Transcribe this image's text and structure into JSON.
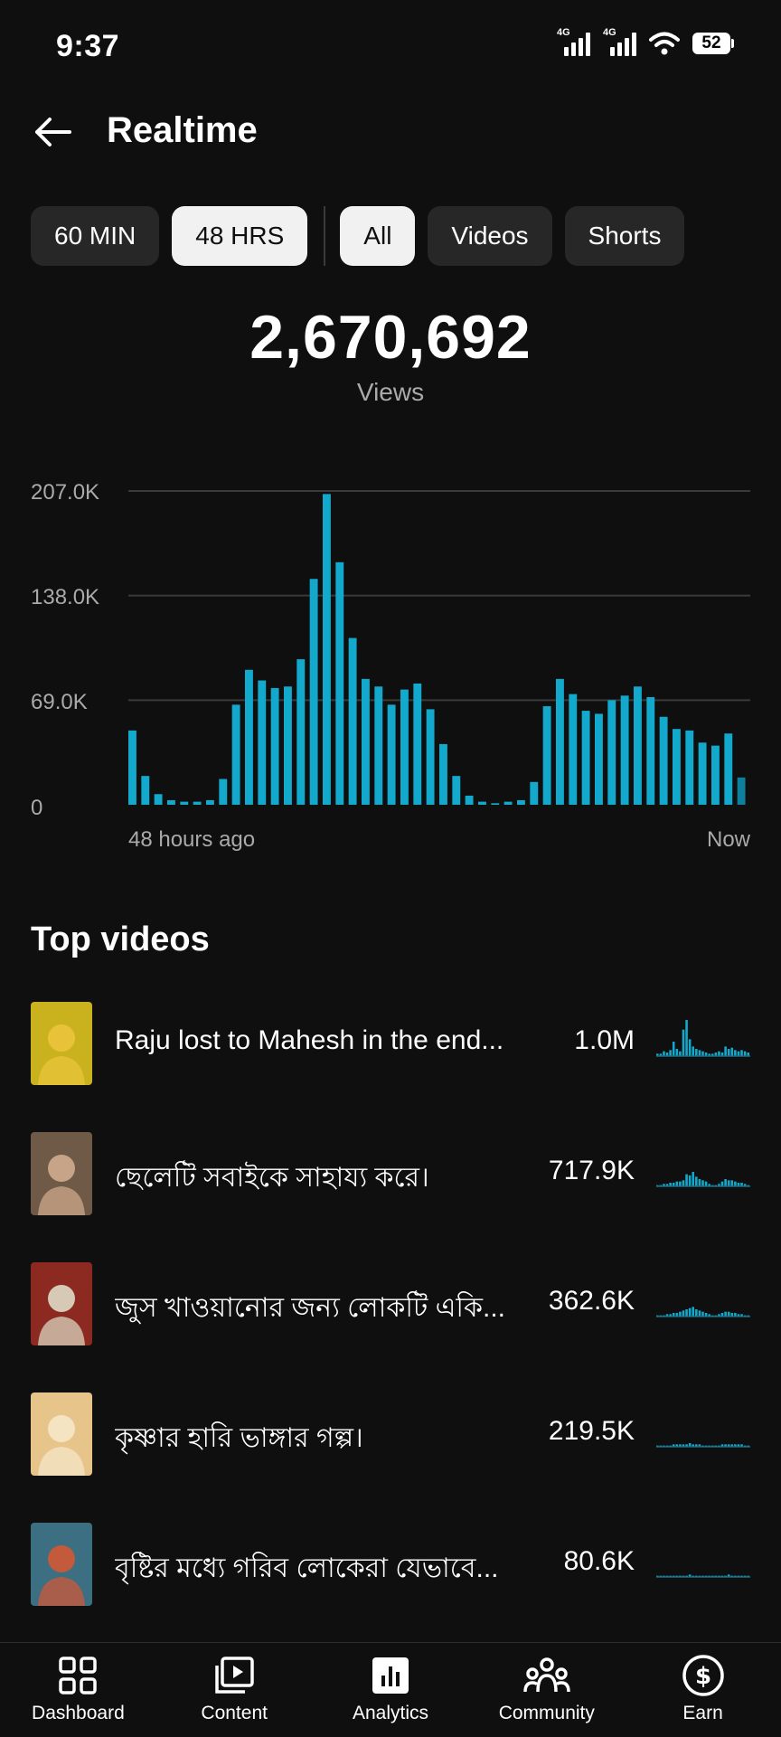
{
  "status_bar": {
    "time": "9:37",
    "network_1": "4G",
    "network_2": "4G",
    "battery": "52",
    "icons": [
      "signal-icon",
      "signal-icon",
      "wifi-icon",
      "battery-icon"
    ]
  },
  "header": {
    "title": "Realtime",
    "back_icon": "arrow-left-icon"
  },
  "time_filters": [
    {
      "label": "60 MIN",
      "active": false
    },
    {
      "label": "48 HRS",
      "active": true
    }
  ],
  "type_filters": [
    {
      "label": "All",
      "active": true
    },
    {
      "label": "Videos",
      "active": false
    },
    {
      "label": "Shorts",
      "active": false
    }
  ],
  "total": {
    "value": "2,670,692",
    "label": "Views"
  },
  "chart_data": {
    "type": "bar",
    "y_ticks": [
      "207.0K",
      "138.0K",
      "69.0K",
      "0"
    ],
    "ylim": [
      0,
      207000
    ],
    "x_start_label": "48 hours ago",
    "x_end_label": "Now",
    "bar_color": "#12a9cc",
    "grid": true,
    "values": [
      49000,
      19000,
      7000,
      3000,
      2000,
      2000,
      3000,
      17000,
      66000,
      89000,
      82000,
      77000,
      78000,
      96000,
      149000,
      205000,
      160000,
      110000,
      83000,
      78000,
      66000,
      76000,
      80000,
      63000,
      40000,
      19000,
      6000,
      2000,
      1000,
      2000,
      3000,
      15000,
      65000,
      83000,
      73000,
      62000,
      60000,
      69000,
      72000,
      78000,
      71000,
      58000,
      50000,
      49000,
      41000,
      39000,
      47000,
      18000
    ]
  },
  "top_videos": {
    "title": "Top videos",
    "items": [
      {
        "title": "Raju lost to Mahesh in the end...",
        "views": "1.0M",
        "thumb_bg": "#c9b21e",
        "thumb_fg": "#e8c33a",
        "spark": [
          2,
          2,
          4,
          3,
          5,
          12,
          6,
          4,
          22,
          30,
          14,
          8,
          6,
          5,
          4,
          3,
          2,
          2,
          3,
          4,
          3,
          8,
          6,
          7,
          5,
          4,
          5,
          4,
          3
        ]
      },
      {
        "title": "ছেলেটি সবাইকে সাহায্য করে।",
        "views": "717.9K",
        "thumb_bg": "#6e5a46",
        "thumb_fg": "#c7a387",
        "spark": [
          1,
          1,
          2,
          2,
          3,
          3,
          4,
          4,
          5,
          10,
          9,
          12,
          8,
          6,
          5,
          4,
          2,
          1,
          1,
          2,
          4,
          6,
          5,
          5,
          4,
          3,
          3,
          2,
          1
        ]
      },
      {
        "title": "জুস খাওয়ানোর জন্য লোকটি একি...",
        "views": "362.6K",
        "thumb_bg": "#8c2a22",
        "thumb_fg": "#d6c9b5",
        "spark": [
          1,
          1,
          1,
          2,
          2,
          3,
          3,
          4,
          5,
          6,
          7,
          8,
          6,
          5,
          4,
          3,
          2,
          1,
          1,
          2,
          3,
          4,
          4,
          3,
          3,
          2,
          2,
          1,
          1
        ]
      },
      {
        "title": "কৃষ্ণার হারি ভাঙ্গার গল্প।",
        "views": "219.5K",
        "thumb_bg": "#e7c48a",
        "thumb_fg": "#f4e4c2",
        "spark": [
          1,
          1,
          1,
          1,
          1,
          2,
          2,
          2,
          2,
          2,
          3,
          2,
          2,
          2,
          1,
          1,
          1,
          1,
          1,
          1,
          2,
          2,
          2,
          2,
          2,
          2,
          2,
          1,
          1
        ]
      },
      {
        "title": "বৃষ্টির মধ্যে গরিব লোকেরা যেভাবে...",
        "views": "80.6K",
        "thumb_bg": "#3c6f82",
        "thumb_fg": "#c35a3c",
        "spark": [
          1,
          1,
          1,
          1,
          1,
          1,
          1,
          1,
          1,
          1,
          2,
          1,
          1,
          1,
          1,
          1,
          1,
          1,
          1,
          1,
          1,
          1,
          2,
          1,
          1,
          1,
          1,
          1,
          1
        ]
      }
    ]
  },
  "bottom_nav": [
    {
      "label": "Dashboard",
      "icon": "dashboard-icon"
    },
    {
      "label": "Content",
      "icon": "content-icon"
    },
    {
      "label": "Analytics",
      "icon": "analytics-icon"
    },
    {
      "label": "Community",
      "icon": "community-icon"
    },
    {
      "label": "Earn",
      "icon": "earn-icon"
    }
  ]
}
